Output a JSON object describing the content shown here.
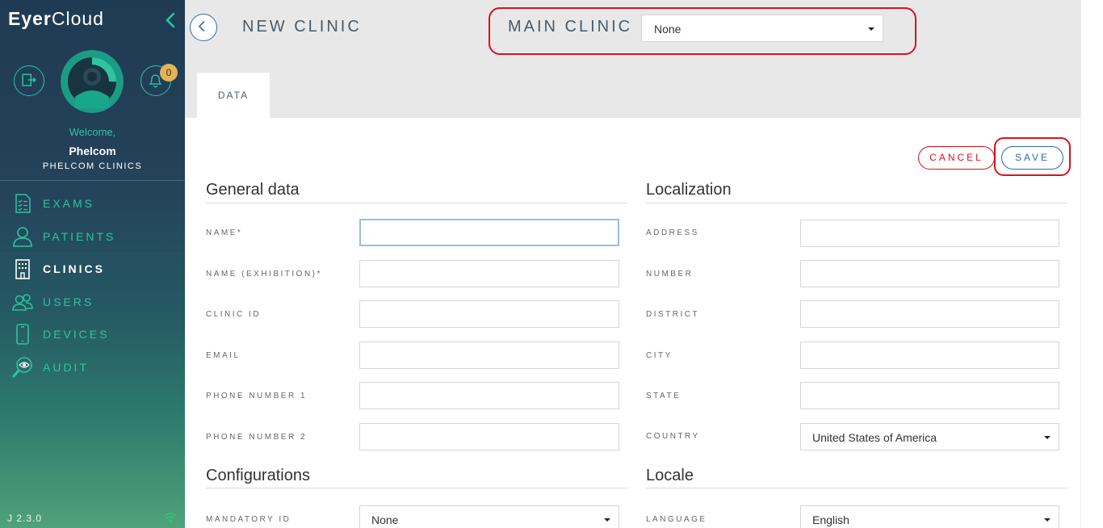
{
  "sidebar": {
    "logo_bold": "Eyer",
    "logo_light": "Cloud",
    "badge_count": "0",
    "welcome": "Welcome,",
    "username": "Phelcom",
    "org": "PHELCOM CLINICS",
    "items": [
      {
        "label": "EXAMS",
        "icon": "exam-list-icon"
      },
      {
        "label": "PATIENTS",
        "icon": "user-icon"
      },
      {
        "label": "CLINICS",
        "icon": "building-icon",
        "active": true
      },
      {
        "label": "USERS",
        "icon": "users-icon"
      },
      {
        "label": "DEVICES",
        "icon": "phone-icon"
      },
      {
        "label": "AUDIT",
        "icon": "magnifier-eye-icon"
      }
    ],
    "version": "J 2.3.0"
  },
  "header": {
    "title": "NEW CLINIC",
    "main_clinic_label": "MAIN CLINIC",
    "main_clinic_value": "None",
    "tab": "DATA"
  },
  "actions": {
    "cancel": "CANCEL",
    "save": "SAVE"
  },
  "general": {
    "title": "General data",
    "fields": [
      {
        "label": "NAME*",
        "value": ""
      },
      {
        "label": "NAME (EXHIBITION)*",
        "value": ""
      },
      {
        "label": "CLINIC ID",
        "value": ""
      },
      {
        "label": "EMAIL",
        "value": ""
      },
      {
        "label": "PHONE NUMBER 1",
        "value": ""
      },
      {
        "label": "PHONE NUMBER 2",
        "value": ""
      }
    ]
  },
  "localization": {
    "title": "Localization",
    "fields": [
      {
        "label": "ADDRESS",
        "value": ""
      },
      {
        "label": "NUMBER",
        "value": ""
      },
      {
        "label": "DISTRICT",
        "value": ""
      },
      {
        "label": "CITY",
        "value": ""
      },
      {
        "label": "STATE",
        "value": ""
      },
      {
        "label": "COUNTRY",
        "value": "United States of America"
      }
    ]
  },
  "configurations": {
    "title": "Configurations",
    "mandatory_id_label": "MANDATORY ID",
    "mandatory_id_value": "None"
  },
  "locale": {
    "title": "Locale",
    "language_label": "LANGUAGE",
    "language_value": "English"
  },
  "colors": {
    "accent": "#2ec4a0",
    "primary": "#2d6ea8",
    "danger": "#d9121c"
  }
}
